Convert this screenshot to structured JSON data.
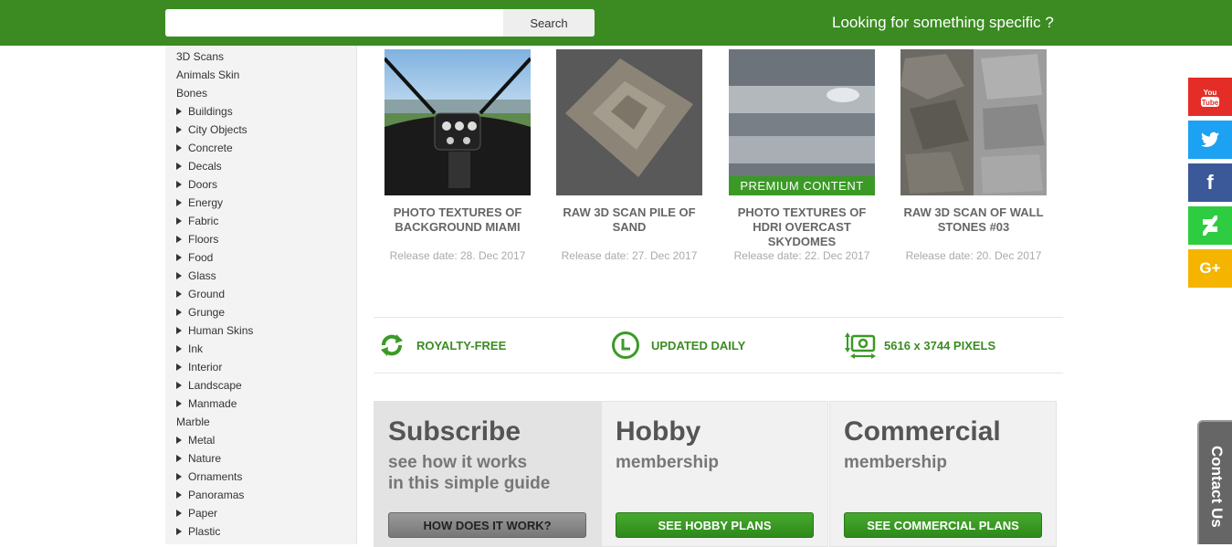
{
  "header": {
    "search_placeholder": "",
    "search_button": "Search",
    "tagline": "Looking for something specific ?"
  },
  "sidebar": {
    "items": [
      {
        "label": "3D Scans",
        "expandable": false
      },
      {
        "label": "Animals Skin",
        "expandable": false
      },
      {
        "label": "Bones",
        "expandable": false
      },
      {
        "label": "Buildings",
        "expandable": true
      },
      {
        "label": "City Objects",
        "expandable": true
      },
      {
        "label": "Concrete",
        "expandable": true
      },
      {
        "label": "Decals",
        "expandable": true
      },
      {
        "label": "Doors",
        "expandable": true
      },
      {
        "label": "Energy",
        "expandable": true
      },
      {
        "label": "Fabric",
        "expandable": true
      },
      {
        "label": "Floors",
        "expandable": true
      },
      {
        "label": "Food",
        "expandable": true
      },
      {
        "label": "Glass",
        "expandable": true
      },
      {
        "label": "Ground",
        "expandable": true
      },
      {
        "label": "Grunge",
        "expandable": true
      },
      {
        "label": "Human Skins",
        "expandable": true
      },
      {
        "label": "Ink",
        "expandable": true
      },
      {
        "label": "Interior",
        "expandable": true
      },
      {
        "label": "Landscape",
        "expandable": true
      },
      {
        "label": "Manmade",
        "expandable": true
      },
      {
        "label": "Marble",
        "expandable": false
      },
      {
        "label": "Metal",
        "expandable": true
      },
      {
        "label": "Nature",
        "expandable": true
      },
      {
        "label": "Ornaments",
        "expandable": true
      },
      {
        "label": "Panoramas",
        "expandable": true
      },
      {
        "label": "Paper",
        "expandable": true
      },
      {
        "label": "Plastic",
        "expandable": true
      }
    ]
  },
  "products": [
    {
      "title": "PHOTO TEXTURES OF BACKGROUND MIAMI",
      "date": "Release date: 28. Dec 2017",
      "premium": "",
      "thumb": "helicopter-cockpit"
    },
    {
      "title": "RAW 3D SCAN PILE OF SAND",
      "date": "Release date: 27. Dec 2017",
      "premium": "",
      "thumb": "sand-pile"
    },
    {
      "title": "PHOTO TEXTURES OF HDRI OVERCAST SKYDOMES",
      "date": "Release date: 22. Dec 2017",
      "premium": "PREMIUM CONTENT",
      "thumb": "overcast-sky"
    },
    {
      "title": "RAW 3D SCAN OF WALL STONES #03",
      "date": "Release date: 20. Dec 2017",
      "premium": "",
      "thumb": "wall-stones"
    }
  ],
  "features": [
    {
      "label": "ROYALTY-FREE",
      "icon": "recycle-arrows-icon"
    },
    {
      "label": "UPDATED DAILY",
      "icon": "clock-icon"
    },
    {
      "label": "5616 x 3744 PIXELS",
      "icon": "camera-resize-icon"
    }
  ],
  "plans": [
    {
      "heading": "Subscribe",
      "sub1": "see how it works",
      "sub2": "in this simple guide",
      "button": "HOW DOES IT WORK?"
    },
    {
      "heading": "Hobby",
      "sub1": "membership",
      "sub2": "",
      "button": "SEE HOBBY PLANS"
    },
    {
      "heading": "Commercial",
      "sub1": "membership",
      "sub2": "",
      "button": "SEE COMMERCIAL PLANS"
    }
  ],
  "social": [
    {
      "icon": "youtube-icon",
      "color": "#e52d27",
      "glyph": "You Tube"
    },
    {
      "icon": "twitter-icon",
      "color": "#1da1f2",
      "glyph": ""
    },
    {
      "icon": "facebook-icon",
      "color": "#3b5998",
      "glyph": "f"
    },
    {
      "icon": "deviantart-icon",
      "color": "#2ecc40",
      "glyph": ""
    },
    {
      "icon": "google-plus-icon",
      "color": "#f5b400",
      "glyph": "G+"
    }
  ],
  "contact": {
    "label": "Contact Us"
  },
  "colors": {
    "brand_green": "#3b8b22",
    "button_green": "#3b9a26"
  }
}
